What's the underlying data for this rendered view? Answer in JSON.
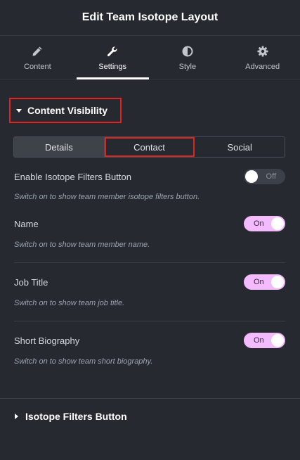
{
  "header": {
    "title": "Edit Team Isotope Layout"
  },
  "tabs": [
    {
      "label": "Content",
      "icon": "pencil-icon",
      "active": false
    },
    {
      "label": "Settings",
      "icon": "wrench-icon",
      "active": true
    },
    {
      "label": "Style",
      "icon": "half-circle-icon",
      "active": false
    },
    {
      "label": "Advanced",
      "icon": "gear-icon",
      "active": false
    }
  ],
  "section": {
    "title": "Content Visibility"
  },
  "segment": {
    "options": [
      "Details",
      "Contact",
      "Social"
    ],
    "selected": "Details"
  },
  "controls": [
    {
      "label": "Enable Isotope Filters Button",
      "description": "Switch on to show team member isotope filters button.",
      "state": "Off"
    },
    {
      "label": "Name",
      "description": "Switch on to show team member name.",
      "state": "On"
    },
    {
      "label": "Job Title",
      "description": "Switch on to show team job title.",
      "state": "On"
    },
    {
      "label": "Short Biography",
      "description": "Switch on to show team short biography.",
      "state": "On"
    }
  ],
  "collapsed_section": {
    "title": "Isotope Filters Button"
  },
  "colors": {
    "background": "#26292f",
    "toggle_on": "#f3bafd",
    "highlight": "#e02424"
  }
}
